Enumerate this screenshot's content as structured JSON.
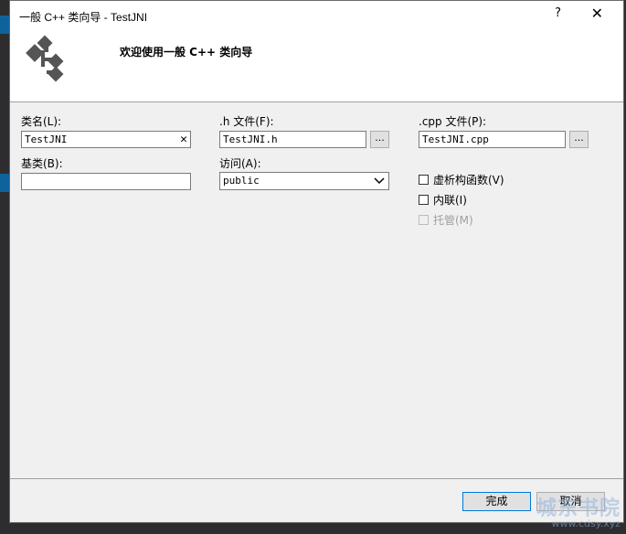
{
  "window": {
    "title": "一般 C++ 类向导 - TestJNI",
    "help": "?",
    "close": "✕"
  },
  "banner": {
    "welcome": "欢迎使用一般  C++  类向导",
    "icon": "class-wizard-icon"
  },
  "form": {
    "class_name_label": "类名(L):",
    "class_name_value": "TestJNI",
    "clear": "✕",
    "h_file_label": ".h 文件(F):",
    "h_file_value": "TestJNI.h",
    "cpp_file_label": ".cpp 文件(P):",
    "cpp_file_value": "TestJNI.cpp",
    "browse": "...",
    "base_label": "基类(B):",
    "base_value": "",
    "access_label": "访问(A):",
    "access_value": "public",
    "options": [
      {
        "label": "虚析构函数(V)",
        "checked": false,
        "enabled": true
      },
      {
        "label": "内联(I)",
        "checked": false,
        "enabled": true
      },
      {
        "label": "托管(M)",
        "checked": false,
        "enabled": false
      }
    ]
  },
  "buttons": {
    "finish": "完成",
    "cancel": "取消"
  },
  "watermark": {
    "main": "城东书院",
    "sub": "www.cdsy.xyz"
  }
}
